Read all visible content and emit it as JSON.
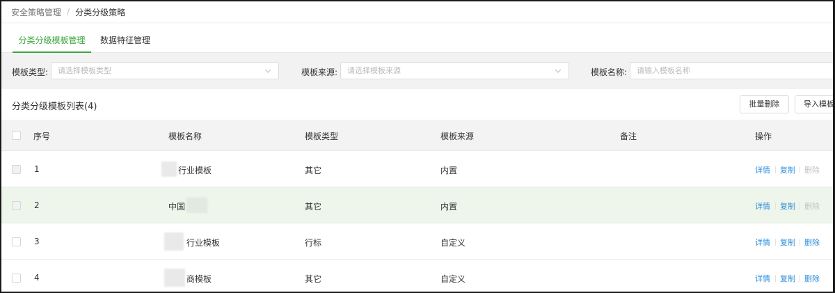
{
  "breadcrumb": {
    "parent": "安全策略管理",
    "separator": "/",
    "current": "分类分级策略"
  },
  "tabs": [
    {
      "label": "分类分级模板管理",
      "active": true
    },
    {
      "label": "数据特征管理",
      "active": false
    }
  ],
  "filters": {
    "template_type": {
      "label": "模板类型:",
      "placeholder": "请选择模板类型"
    },
    "template_source": {
      "label": "模板来源:",
      "placeholder": "请选择模板来源"
    },
    "template_name": {
      "label": "模板名称:",
      "placeholder": "请输入模板名称"
    }
  },
  "list": {
    "title": "分类分级模板列表(4)",
    "batch_delete_label": "批量删除",
    "import_label": "导入模板"
  },
  "table": {
    "headers": [
      "序号",
      "模板名称",
      "模板类型",
      "模板来源",
      "备注",
      "操作"
    ],
    "rows": [
      {
        "index": "1",
        "name": "行业模板",
        "type": "其它",
        "source": "内置",
        "note": "",
        "delete_enabled": false
      },
      {
        "index": "2",
        "name": "中国",
        "type": "其它",
        "source": "内置",
        "note": "",
        "delete_enabled": false
      },
      {
        "index": "3",
        "name": "行业模板",
        "type": "行标",
        "source": "自定义",
        "note": "",
        "delete_enabled": true
      },
      {
        "index": "4",
        "name": "商模板",
        "type": "其它",
        "source": "自定义",
        "note": "",
        "delete_enabled": true
      }
    ],
    "actions": {
      "detail": "详情",
      "copy": "复制",
      "delete": "删除"
    }
  },
  "colors": {
    "accent": "#3aa63a",
    "link": "#2f8fdc",
    "row_hover": "#eef5ea"
  },
  "icons": {
    "select_chevron": "chevron-down-icon"
  }
}
